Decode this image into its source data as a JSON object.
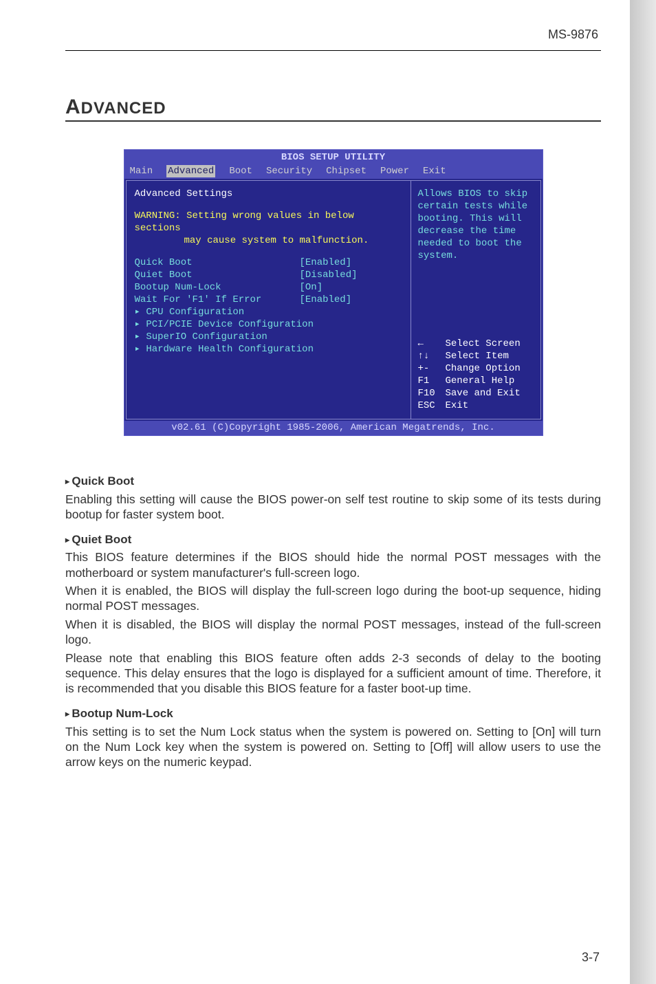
{
  "doc_id": "MS-9876",
  "section_title": "Advanced",
  "bios": {
    "title": "BIOS SETUP UTILITY",
    "menu": [
      "Main",
      "Advanced",
      "Boot",
      "Security",
      "Chipset",
      "Power",
      "Exit"
    ],
    "menu_selected": "Advanced",
    "settings_heading": "Advanced Settings",
    "warning_l1": "WARNING: Setting wrong values in below sections",
    "warning_l2": "may cause system to malfunction.",
    "rows": [
      {
        "label": "Quick Boot",
        "value": "[Enabled]"
      },
      {
        "label": "Quiet Boot",
        "value": "[Disabled]"
      },
      {
        "label": "Bootup Num-Lock",
        "value": "[On]"
      },
      {
        "label": "Wait For 'F1' If Error",
        "value": "[Enabled]"
      }
    ],
    "subs": [
      "CPU Configuration",
      "PCI/PCIE Device Configuration",
      "SuperIO Configuration",
      "Hardware Health Configuration"
    ],
    "help_top": "Allows BIOS to skip certain tests while booting. This will decrease the time needed to boot the system.",
    "help_keys": [
      {
        "k": "←",
        "d": "Select Screen"
      },
      {
        "k": "↑↓",
        "d": "Select Item"
      },
      {
        "k": "+-",
        "d": "Change Option"
      },
      {
        "k": "F1",
        "d": "General Help"
      },
      {
        "k": "F10",
        "d": "Save and Exit"
      },
      {
        "k": "ESC",
        "d": "Exit"
      }
    ],
    "footer": "v02.61 (C)Copyright 1985-2006, American Megatrends, Inc."
  },
  "items": {
    "quick_boot": {
      "title": "Quick Boot",
      "p1": "Enabling this setting will cause the BIOS power-on self test routine to skip some of its tests during bootup for faster system boot."
    },
    "quiet_boot": {
      "title": "Quiet Boot",
      "p1": "This BIOS feature determines if the BIOS should hide the normal POST messages with the motherboard or system manufacturer's full-screen logo.",
      "p2": "When it is enabled, the BIOS will display the full-screen logo during the boot-up sequence, hiding normal POST messages.",
      "p3": "When it is disabled, the BIOS will display the normal POST messages, instead of the full-screen logo.",
      "p4": "Please note that enabling this BIOS feature often adds 2-3 seconds of delay to the booting sequence. This delay ensures that the logo is displayed for a sufficient amount of time. Therefore, it is recommended that you disable this BIOS feature for a faster boot-up time."
    },
    "numlock": {
      "title": "Bootup Num-Lock",
      "p1": "This setting is to set the Num Lock status when the system is powered on. Setting to [On] will turn on the Num Lock key when the system is powered on. Setting to [Off] will allow users to use the arrow keys on the numeric keypad."
    }
  },
  "page_number": "3-7"
}
